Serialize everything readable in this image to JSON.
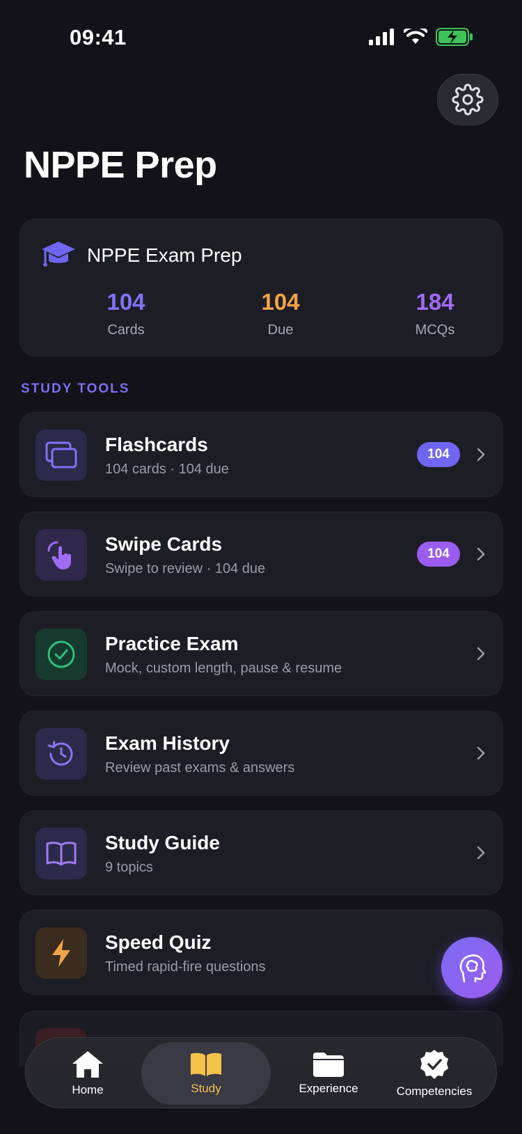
{
  "status": {
    "time": "09:41"
  },
  "page": {
    "title": "NPPE Prep"
  },
  "summary": {
    "title": "NPPE Exam Prep",
    "stats": [
      {
        "value": "104",
        "label": "Cards",
        "color": "#7d74f5"
      },
      {
        "value": "104",
        "label": "Due",
        "color": "#f0a347"
      },
      {
        "value": "184",
        "label": "MCQs",
        "color": "#a06af2"
      }
    ]
  },
  "section": {
    "label": "STUDY TOOLS"
  },
  "tools": [
    {
      "title": "Flashcards",
      "subtitle": "104 cards · 104 due",
      "badge": "104",
      "icon": "cards-icon"
    },
    {
      "title": "Swipe Cards",
      "subtitle": "Swipe to review · 104 due",
      "badge": "104",
      "icon": "hand-tap-icon"
    },
    {
      "title": "Practice Exam",
      "subtitle": "Mock, custom length, pause & resume",
      "icon": "check-circle-icon"
    },
    {
      "title": "Exam History",
      "subtitle": "Review past exams & answers",
      "icon": "history-icon"
    },
    {
      "title": "Study Guide",
      "subtitle": "9 topics",
      "icon": "book-icon"
    },
    {
      "title": "Speed Quiz",
      "subtitle": "Timed rapid-fire questions",
      "icon": "lightning-icon"
    }
  ],
  "tabs": [
    {
      "label": "Home",
      "icon": "home-icon"
    },
    {
      "label": "Study",
      "icon": "book-open-icon",
      "active": true
    },
    {
      "label": "Experience",
      "icon": "folder-icon"
    },
    {
      "label": "Competencies",
      "icon": "badge-check-icon"
    }
  ],
  "colors": {
    "accent": "#6e66f0",
    "purple": "#9b5cf0",
    "study_active": "#f5c24a",
    "green": "#2fbf7a",
    "orange": "#f0a347"
  }
}
